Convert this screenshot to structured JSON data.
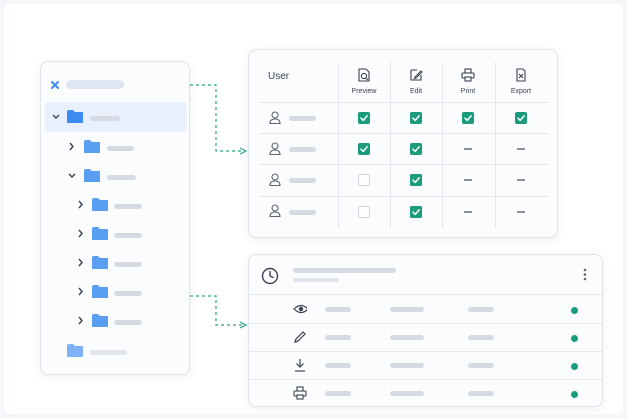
{
  "permissions": {
    "user_header": "User",
    "columns": [
      {
        "label": "Preview",
        "icon": "preview-icon"
      },
      {
        "label": "Edit",
        "icon": "edit-icon"
      },
      {
        "label": "Print",
        "icon": "print-icon"
      },
      {
        "label": "Export",
        "icon": "export-icon"
      }
    ],
    "rows": [
      [
        "checked",
        "checked",
        "checked",
        "checked"
      ],
      [
        "checked",
        "checked",
        "none",
        "none"
      ],
      [
        "unchecked",
        "checked",
        "none",
        "none"
      ],
      [
        "unchecked",
        "checked",
        "none",
        "none"
      ]
    ]
  },
  "activity": {
    "rows": [
      {
        "icon": "eye-icon",
        "status": "active"
      },
      {
        "icon": "pencil-icon",
        "status": "active"
      },
      {
        "icon": "download-icon",
        "status": "active"
      },
      {
        "icon": "printer-icon",
        "status": "active"
      }
    ]
  },
  "colors": {
    "accent_blue": "#3d8bf0",
    "check_green": "#1a9b7c",
    "connector": "#2aa886"
  }
}
